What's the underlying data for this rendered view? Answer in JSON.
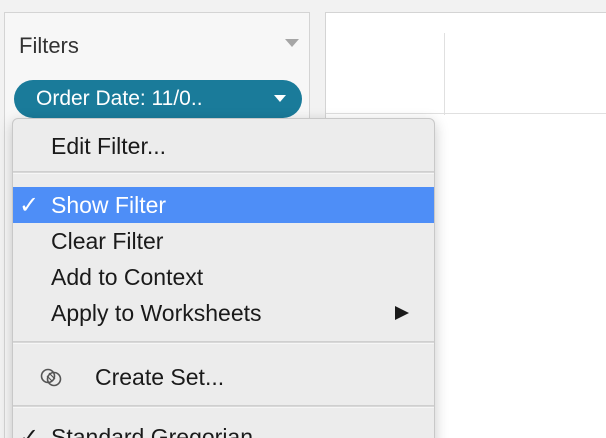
{
  "filters_panel": {
    "title": "Filters"
  },
  "filter_pill": {
    "label": "Order Date: 11/0..",
    "color": "#1a7b9a"
  },
  "context_menu": {
    "items": [
      {
        "label": "Edit Filter...",
        "checked": false,
        "highlighted": false
      },
      {
        "label": "Show Filter",
        "checked": true,
        "highlighted": true,
        "check": "✓"
      },
      {
        "label": "Clear Filter",
        "checked": false,
        "highlighted": false
      },
      {
        "label": "Add to Context",
        "checked": false,
        "highlighted": false
      },
      {
        "label": "Apply to Worksheets",
        "checked": false,
        "highlighted": false,
        "has_submenu": true
      },
      {
        "label": "Create Set...",
        "checked": false,
        "highlighted": false,
        "icon": "venn-set-icon"
      },
      {
        "label": "Standard Gregorian",
        "checked": true,
        "highlighted": false,
        "check": "✓"
      }
    ],
    "highlight_color": "#4e8ef7"
  }
}
